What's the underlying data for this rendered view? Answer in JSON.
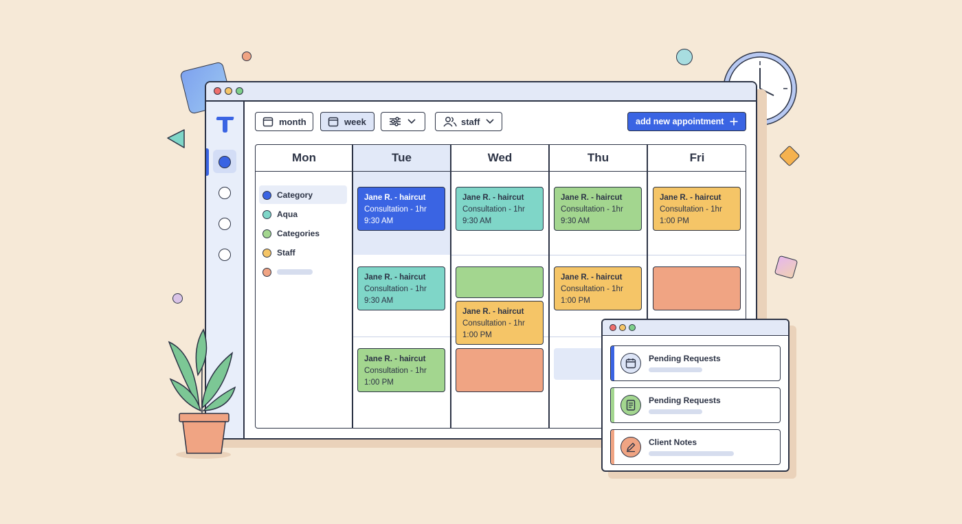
{
  "toolbar": {
    "month_label": "month",
    "week_label": "week",
    "staff_label": "staff",
    "add_label": "add new appointment"
  },
  "days": [
    "Mon",
    "Tue",
    "Wed",
    "Thu",
    "Fri"
  ],
  "categories": [
    {
      "label": "Category",
      "color": "#3a64e3"
    },
    {
      "label": "Aqua",
      "color": "#7fd6c8"
    },
    {
      "label": "Categories",
      "color": "#a3d68f"
    },
    {
      "label": "Staff",
      "color": "#f5c567"
    },
    {
      "label": "",
      "color": "#f0a483"
    }
  ],
  "appointments": {
    "tue_1": {
      "title": "Jane R. - haircut",
      "detail": "Consultation - 1hr",
      "time": "9:30 AM",
      "color": "blue"
    },
    "tue_2": {
      "title": "Jane R. - haircut",
      "detail": "Consultation - 1hr",
      "time": "9:30 AM",
      "color": "aqua"
    },
    "tue_3": {
      "title": "Jane R. - haircut",
      "detail": "Consultation - 1hr",
      "time": "1:00 PM",
      "color": "green"
    },
    "wed_1": {
      "title": "Jane R. - haircut",
      "detail": "Consultation - 1hr",
      "time": "9:30 AM",
      "color": "aqua"
    },
    "wed_3": {
      "title": "Jane R. - haircut",
      "detail": "Consultation - 1hr",
      "time": "1:00 PM",
      "color": "yellow"
    },
    "thu_1": {
      "title": "Jane R. - haircut",
      "detail": "Consultation - 1hr",
      "time": "9:30 AM",
      "color": "green"
    },
    "thu_2": {
      "title": "Jane R. - haircut",
      "detail": "Consultation - 1hr",
      "time": "1:00 PM",
      "color": "yellow"
    },
    "fri_1": {
      "title": "Jane R. - haircut",
      "detail": "Consultation - 1hr",
      "time": "1:00 PM",
      "color": "yellow"
    }
  },
  "panel": {
    "items": [
      {
        "label": "Pending Requests",
        "icon": "calendar-icon",
        "color": "#3a64e3"
      },
      {
        "label": "Pending Requests",
        "icon": "document-icon",
        "color": "#a3d68f"
      },
      {
        "label": "Client Notes",
        "icon": "pencil-icon",
        "color": "#f0a483"
      }
    ]
  },
  "colors": {
    "accent": "#3a64e3",
    "aqua": "#7fd6c8",
    "green": "#a3d68f",
    "yellow": "#f5c567",
    "salmon": "#f0a483",
    "background": "#f6e9d7"
  }
}
